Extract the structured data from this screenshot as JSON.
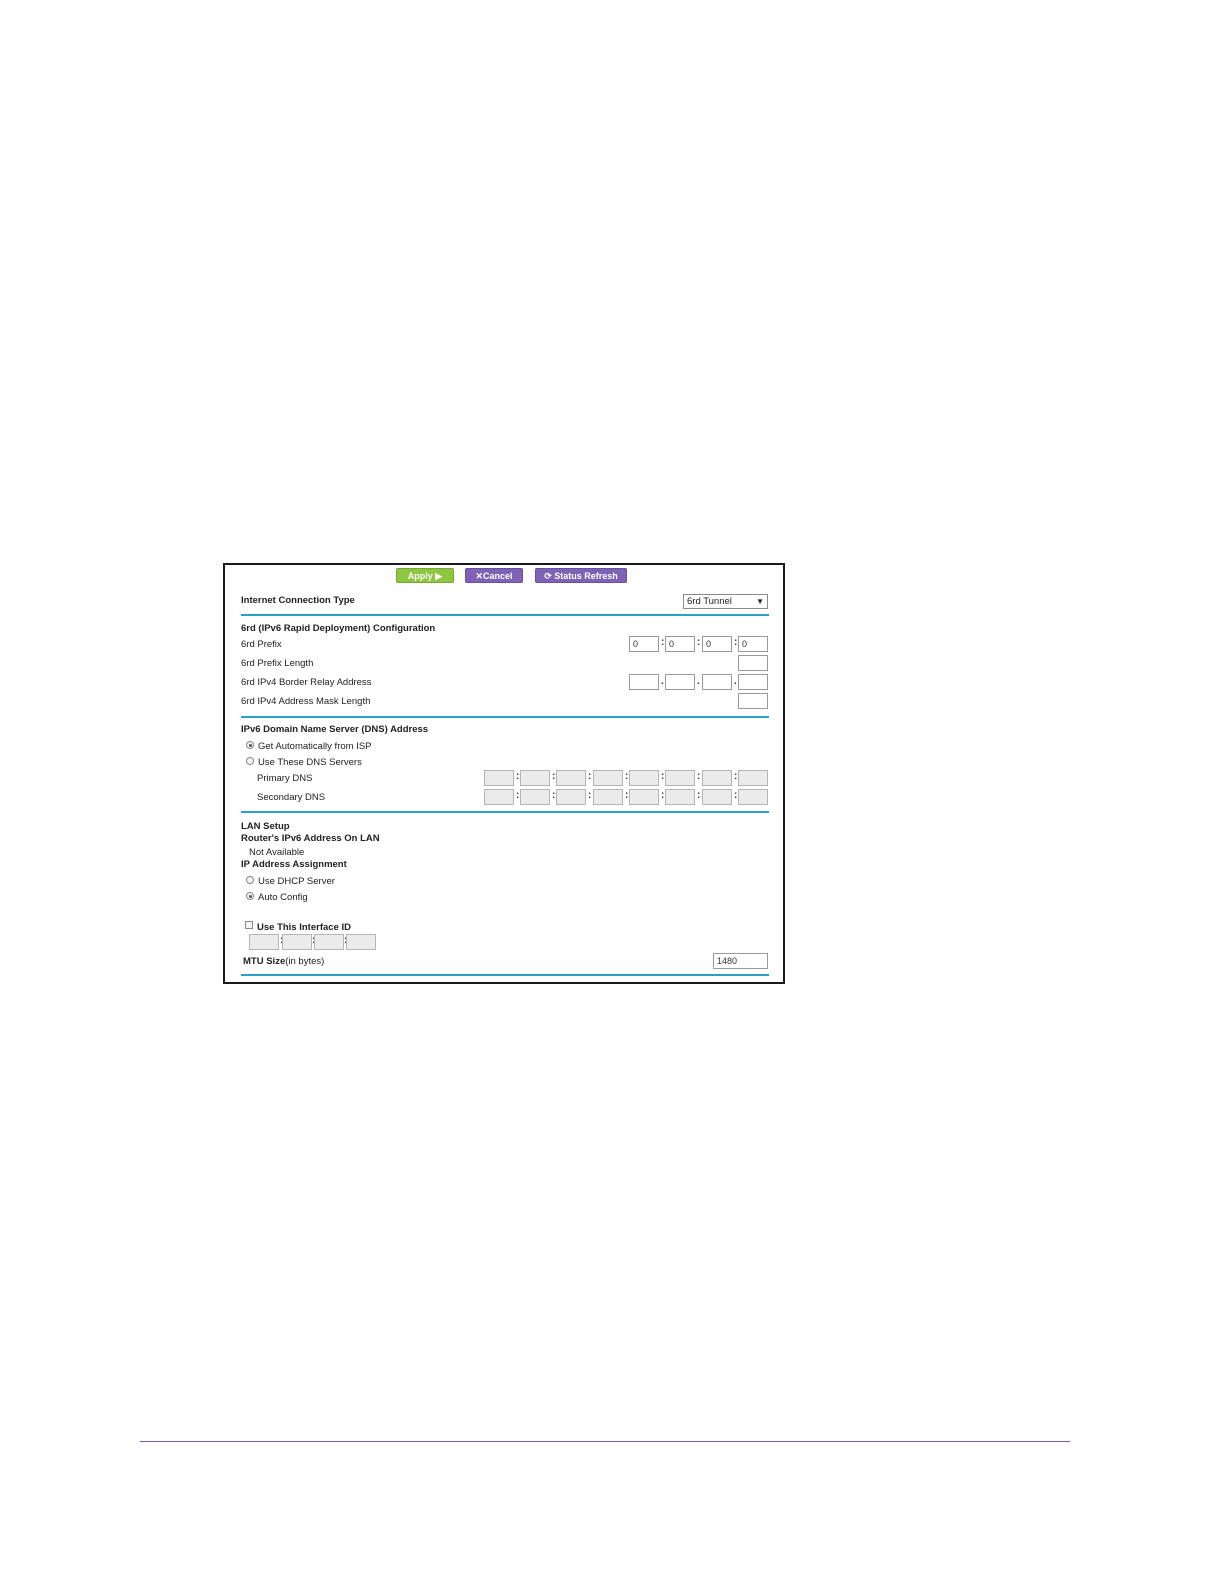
{
  "toolbar": {
    "apply_label": "Apply ▶",
    "cancel_label": "✕Cancel",
    "refresh_label": "⟳ Status Refresh"
  },
  "connection": {
    "type_label": "Internet Connection Type",
    "type_value": "6rd Tunnel"
  },
  "sixrd": {
    "heading": "6rd (IPv6 Rapid Deployment) Configuration",
    "prefix_label": "6rd Prefix",
    "prefix_values": [
      "0",
      "0",
      "0",
      "0"
    ],
    "prefix_length_label": "6rd Prefix Length",
    "relay_label": "6rd IPv4 Border Relay Address",
    "mask_label": "6rd IPv4 Address Mask Length"
  },
  "dns": {
    "heading": "IPv6 Domain Name Server (DNS) Address",
    "auto_label": "Get Automatically from ISP",
    "manual_label": "Use These DNS Servers",
    "primary_label": "Primary DNS",
    "secondary_label": "Secondary DNS"
  },
  "lan": {
    "heading": "LAN Setup",
    "router_addr_label": "Router's IPv6 Address On LAN",
    "router_addr_value": "Not Available",
    "assign_label": "IP Address Assignment",
    "dhcp_label": "Use DHCP Server",
    "auto_label": "Auto Config",
    "interface_id_label": "Use This Interface ID",
    "mtu_label": "MTU Size",
    "mtu_unit": "(in bytes)",
    "mtu_value": "1480"
  },
  "colors": {
    "apply": "#8dc63f",
    "cancel": "#7d62b6",
    "rule": "#2a9fc9",
    "footer_line": "#7a5aa6"
  }
}
